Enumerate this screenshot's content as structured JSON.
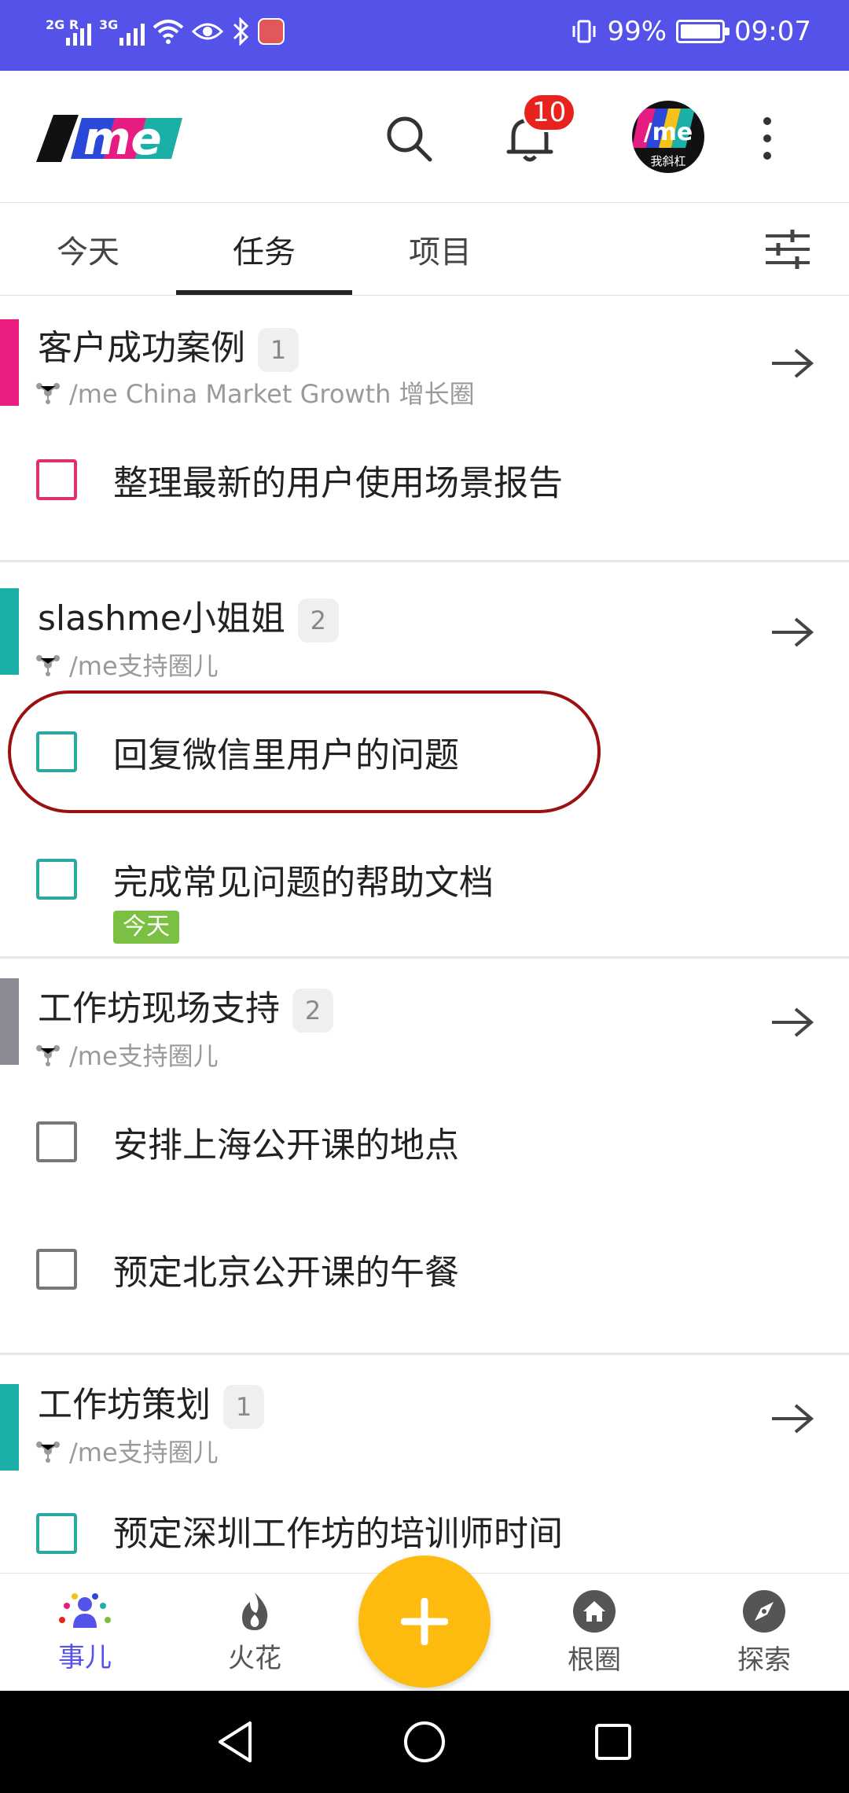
{
  "status_bar": {
    "sim1_label": "2G R",
    "sim2_label": "3G",
    "battery_text": "99%",
    "battery_level": 0.99,
    "time": "09:07",
    "icons": [
      "signal-icon",
      "wifi-icon",
      "eye-icon",
      "bluetooth-icon",
      "app-notification-icon",
      "vibrate-icon",
      "battery-icon"
    ]
  },
  "header": {
    "logo_text": "/me",
    "notification_count": "10",
    "avatar_caption": "我斜杠",
    "avatar_text": "/me",
    "colors": {
      "brand": "#5452e8",
      "badge": "#e8231d"
    }
  },
  "tabs": [
    {
      "label": "今天",
      "active": false
    },
    {
      "label": "任务",
      "active": true
    },
    {
      "label": "项目",
      "active": false
    }
  ],
  "sections": [
    {
      "title": "客户成功案例",
      "count": "1",
      "circle": "/me China Market Growth 增长圈",
      "color": "#e91e80",
      "tasks": [
        {
          "text": "整理最新的用户使用场景报告",
          "checkbox_color": "#e0306a"
        }
      ]
    },
    {
      "title": "slashme小姐姐",
      "count": "2",
      "circle": "/me支持圈儿",
      "color": "#1ab0a8",
      "tasks": [
        {
          "text": "回复微信里用户的问题",
          "checkbox_color": "#2aa8a2",
          "highlighted": true
        },
        {
          "text": "完成常见问题的帮助文档",
          "checkbox_color": "#2aa8a2",
          "tag": "今天"
        }
      ]
    },
    {
      "title": "工作坊现场支持",
      "count": "2",
      "circle": "/me支持圈儿",
      "color": "#8a8a94",
      "tasks": [
        {
          "text": "安排上海公开课的地点",
          "checkbox_color": "#777777"
        },
        {
          "text": "预定北京公开课的午餐",
          "checkbox_color": "#777777"
        }
      ]
    },
    {
      "title": "工作坊策划",
      "count": "1",
      "circle": "/me支持圈儿",
      "color": "#1ab0a8",
      "tasks": [
        {
          "text": "预定深圳工作坊的培训师时间",
          "checkbox_color": "#2aa8a2"
        }
      ]
    }
  ],
  "bottom_nav": [
    {
      "label": "事儿",
      "icon": "people-icon",
      "active": true
    },
    {
      "label": "火花",
      "icon": "flame-icon",
      "active": false
    },
    {
      "label": "根圈",
      "icon": "home-icon",
      "active": false
    },
    {
      "label": "探索",
      "icon": "compass-icon",
      "active": false
    }
  ],
  "fab": {
    "icon": "plus-icon",
    "color": "#fdbb10"
  }
}
